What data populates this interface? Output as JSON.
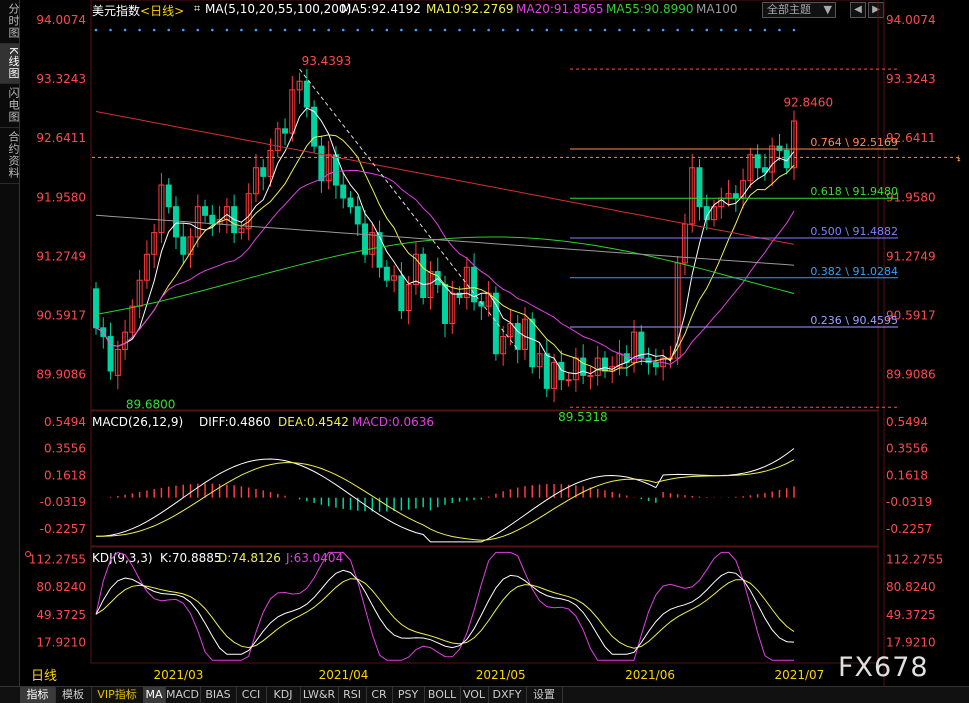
{
  "sidebar": {
    "items": [
      {
        "label": "分时图",
        "active": false
      },
      {
        "label": "K线图",
        "active": true
      },
      {
        "label": "闪电图",
        "active": false
      },
      {
        "label": "合约资料",
        "active": false
      }
    ]
  },
  "header": {
    "symbol": "美元指数",
    "period": "<日线>",
    "ma_label": "MA(5,10,20,55,100,200)",
    "ma5": "MA5:92.4192",
    "ma10": "MA10:92.2769",
    "ma20": "MA20:91.8565",
    "ma55": "MA55:90.8990",
    "ma100": "MA100",
    "theme": "全部主题",
    "prev": "◀",
    "next": "▶"
  },
  "colors": {
    "up": "#ff3b3b",
    "down": "#00d2a0",
    "ma5": "#ffffff",
    "ma10": "#f0f050",
    "ma20": "#e040e0",
    "ma55": "#30d030",
    "ma100": "#999999",
    "ma200": "#d03030",
    "grid": "#8a1a1a",
    "axis": "#ff4a4a",
    "dif": "#ffffff",
    "dea": "#f0f050"
  },
  "main_panel": {
    "yticks": [
      "94.0074",
      "93.3243",
      "92.6411",
      "91.9580",
      "91.2749",
      "90.5917",
      "89.9086"
    ],
    "high_label": "93.4393",
    "low_label": "89.6800",
    "low2_label": "89.5318",
    "recent_high_label": "92.8460",
    "fib_levels": [
      {
        "label": "0.764 \\ 92.5169",
        "value": 92.5169,
        "color": "#ff8a50"
      },
      {
        "label": "0.618 \\ 91.9480",
        "value": 91.948,
        "color": "#30e030"
      },
      {
        "label": "0.500 \\ 91.4882",
        "value": 91.4882,
        "color": "#8080ff"
      },
      {
        "label": "0.382 \\ 91.0284",
        "value": 91.0284,
        "color": "#30a0ff"
      },
      {
        "label": "0.236 \\ 90.4595",
        "value": 90.4595,
        "color": "#a0a0ff"
      }
    ]
  },
  "macd_panel": {
    "label": "MACD(26,12,9)",
    "diff": "DIFF:0.4860",
    "dea": "DEA:0.4542",
    "macd": "MACD:0.0636",
    "yticks": [
      "0.5494",
      "0.3556",
      "0.1618",
      "-0.0319",
      "-0.2257"
    ]
  },
  "kdj_panel": {
    "label": "KDJ(9,3,3)",
    "k": "K:70.8885",
    "d": "D:74.8126",
    "j": "J:63.0404",
    "yticks": [
      "112.2755",
      "80.8240",
      "49.3725",
      "17.9210"
    ]
  },
  "xaxis": {
    "labels": [
      "2021/03",
      "2021/04",
      "2021/05",
      "2021/06",
      "2021/07"
    ]
  },
  "period_tab": "日线",
  "toolbar": {
    "items": [
      {
        "label": "指标",
        "active": true
      },
      {
        "label": "模板"
      },
      {
        "label": "VIP指标",
        "vip": true
      },
      {
        "label": "MA",
        "active": true
      },
      {
        "label": "MACD"
      },
      {
        "label": "BIAS"
      },
      {
        "label": "CCI"
      },
      {
        "label": "KDJ"
      },
      {
        "label": "LW&R"
      },
      {
        "label": "RSI"
      },
      {
        "label": "CR"
      },
      {
        "label": "PSY"
      },
      {
        "label": "BOLL"
      },
      {
        "label": "VOL"
      },
      {
        "label": "DXFY"
      },
      {
        "label": "设置"
      }
    ]
  },
  "watermark": "FX678",
  "chart_data": [
    {
      "type": "candlestick",
      "title": "美元指数 <日线>",
      "ylim": [
        89.5,
        94.0074
      ],
      "candles": {
        "open": [
          90.9,
          90.45,
          90.35,
          89.9,
          90.2,
          90.4,
          90.7,
          91.0,
          91.3,
          91.55,
          92.1,
          91.85,
          91.5,
          91.3,
          91.5,
          91.85,
          91.75,
          91.65,
          91.7,
          91.85,
          91.55,
          91.6,
          92.0,
          92.3,
          92.2,
          92.5,
          92.75,
          92.7,
          93.2,
          93.3,
          93.0,
          92.55,
          92.15,
          92.45,
          92.1,
          91.95,
          91.85,
          91.65,
          91.3,
          91.55,
          91.15,
          91.0,
          91.05,
          90.65,
          90.95,
          91.3,
          90.8,
          91.1,
          90.95,
          90.5,
          90.85,
          90.8,
          91.15,
          90.75,
          90.7,
          90.85,
          90.15,
          90.35,
          90.5,
          90.2,
          90.55,
          90.0,
          90.15,
          89.75,
          90.05,
          89.85,
          89.85,
          90.1,
          89.9,
          89.9,
          90.1,
          89.95,
          90.0,
          90.15,
          90.05,
          90.4,
          90.1,
          90.05,
          90.0,
          90.1,
          90.1,
          91.2,
          91.65,
          92.3,
          91.85,
          91.7,
          91.85,
          91.95,
          92.0,
          91.95,
          92.15,
          92.45,
          92.3,
          92.25,
          92.55,
          92.5,
          92.3
        ],
        "close": [
          90.45,
          90.35,
          89.95,
          90.2,
          90.4,
          90.7,
          91.0,
          91.3,
          91.55,
          92.1,
          91.85,
          91.5,
          91.3,
          91.5,
          91.85,
          91.75,
          91.65,
          91.7,
          91.85,
          91.55,
          91.6,
          92.0,
          92.3,
          92.2,
          92.5,
          92.75,
          92.7,
          93.2,
          93.3,
          93.0,
          92.55,
          92.15,
          92.45,
          92.1,
          91.95,
          91.85,
          91.65,
          91.3,
          91.55,
          91.15,
          91.0,
          91.05,
          90.65,
          90.95,
          91.3,
          90.8,
          91.1,
          90.95,
          90.5,
          90.85,
          90.8,
          91.15,
          90.75,
          90.7,
          90.85,
          90.15,
          90.35,
          90.5,
          90.2,
          90.55,
          90.0,
          90.15,
          89.75,
          90.05,
          89.85,
          89.85,
          90.1,
          89.9,
          89.9,
          90.1,
          89.95,
          90.0,
          90.15,
          90.05,
          90.4,
          90.1,
          90.05,
          90.0,
          90.1,
          90.1,
          91.2,
          91.65,
          92.3,
          91.85,
          91.7,
          91.85,
          91.95,
          92.0,
          91.95,
          92.15,
          92.45,
          92.3,
          92.25,
          92.55,
          92.5,
          92.3,
          92.84
        ],
        "note": "approximate daily OHLC read from the chart"
      },
      "high": 93.4393,
      "low": 89.5318
    },
    {
      "type": "bar",
      "title": "MACD(26,12,9)",
      "ylim": [
        -0.35,
        0.62
      ]
    },
    {
      "type": "line",
      "title": "KDJ(9,3,3)",
      "ylim": [
        -5,
        125
      ]
    }
  ]
}
